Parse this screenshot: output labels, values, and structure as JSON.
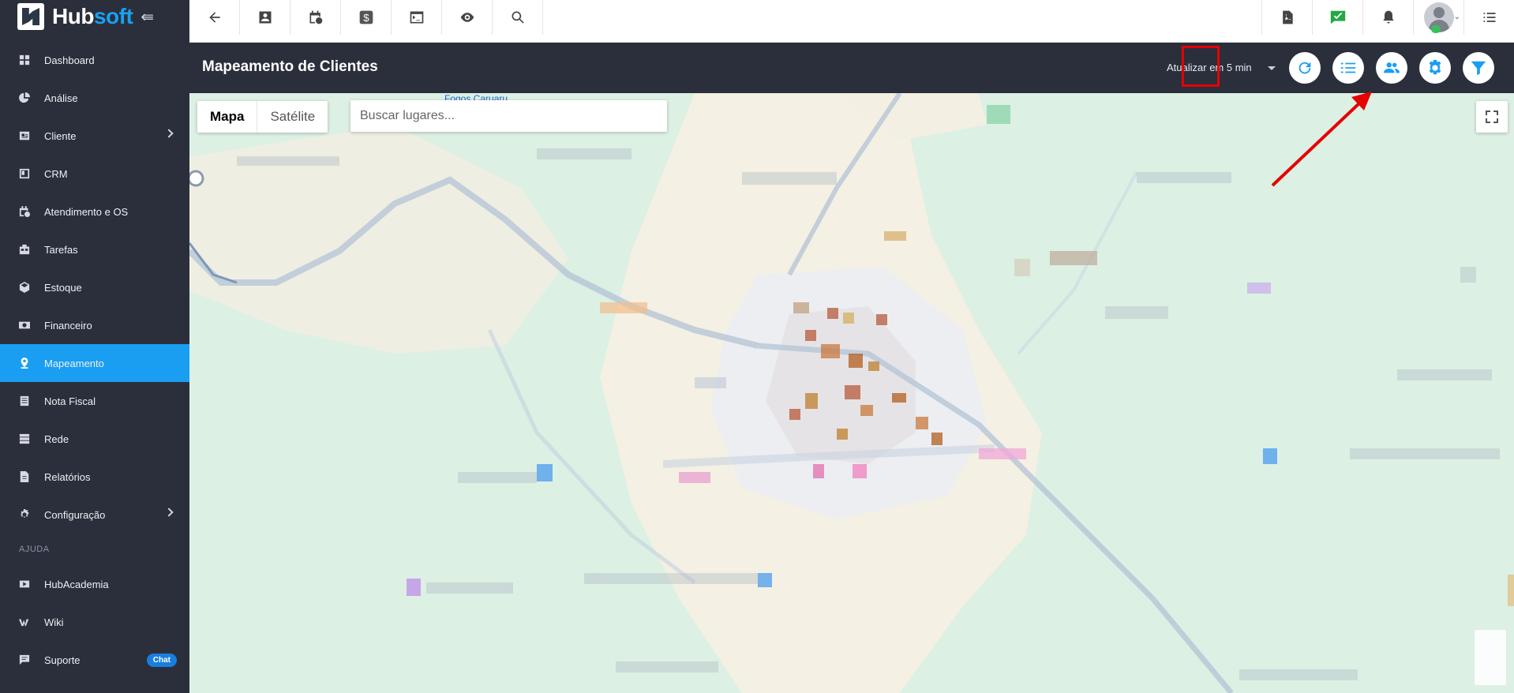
{
  "brand": {
    "name_a": "Hub",
    "name_b": "soft",
    "toggle_icon": "menu-collapse-icon"
  },
  "sidebar": {
    "items": [
      {
        "label": "Dashboard",
        "icon": "dashboard-icon"
      },
      {
        "label": "Análise",
        "icon": "chart-pie-icon"
      },
      {
        "label": "Cliente",
        "icon": "id-card-icon",
        "has_children": true
      },
      {
        "label": "CRM",
        "icon": "crm-icon"
      },
      {
        "label": "Atendimento e OS",
        "icon": "calendar-clock-icon"
      },
      {
        "label": "Tarefas",
        "icon": "tasks-icon"
      },
      {
        "label": "Estoque",
        "icon": "box-icon"
      },
      {
        "label": "Financeiro",
        "icon": "money-icon"
      },
      {
        "label": "Mapeamento",
        "icon": "map-pin-icon",
        "active": true
      },
      {
        "label": "Nota Fiscal",
        "icon": "receipt-icon"
      },
      {
        "label": "Rede",
        "icon": "server-icon"
      },
      {
        "label": "Relatórios",
        "icon": "report-icon"
      },
      {
        "label": "Configuração",
        "icon": "gear-icon",
        "has_children": true
      }
    ],
    "section_help": "AJUDA",
    "help_items": [
      {
        "label": "HubAcademia",
        "icon": "youtube-icon"
      },
      {
        "label": "Wiki",
        "icon": "wikipedia-icon"
      },
      {
        "label": "Suporte",
        "icon": "chat-icon",
        "badge": "Chat"
      }
    ]
  },
  "topbar": {
    "left_buttons": [
      "back-arrow-icon",
      "contact-card-icon",
      "calendar-clock-icon",
      "dollar-icon",
      "terminal-icon",
      "eye-icon",
      "search-icon"
    ],
    "right_buttons": [
      "pdf-icon",
      "checked-message-icon",
      "bell-icon",
      "avatar",
      "list-icon"
    ]
  },
  "page": {
    "title": "Mapeamento de Clientes",
    "refresh_label": "Atualizar em 5 min",
    "actions": [
      "refresh-icon",
      "list-numbered-icon",
      "users-icon",
      "settings-gear-icon",
      "filter-icon"
    ],
    "highlighted_action": "users-icon",
    "highlight_color": "#e60000"
  },
  "map": {
    "type_options": [
      "Mapa",
      "Satélite"
    ],
    "selected_type": "Mapa",
    "search_placeholder": "Buscar lugares...",
    "place_label": "Fogos Caruaru",
    "fullscreen_icon": "fullscreen-icon"
  },
  "colors": {
    "sidebar_bg": "#2a2f3b",
    "accent": "#1a9ef2",
    "map_bg": "#dcf0e4"
  }
}
